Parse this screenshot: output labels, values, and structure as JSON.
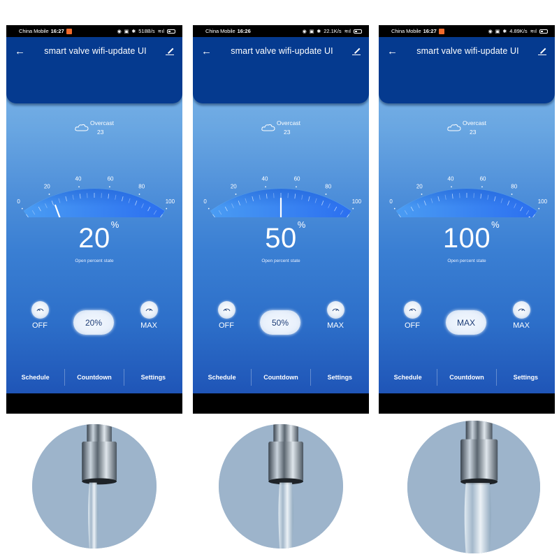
{
  "app": {
    "title": "smart valve wifi-update UI",
    "back_icon": "arrow-left-icon",
    "edit_icon": "pencil-icon"
  },
  "weather": {
    "icon": "cloud-icon",
    "condition": "Overcast",
    "temperature": "23"
  },
  "gauge": {
    "tick_labels": [
      "0",
      "20",
      "40",
      "60",
      "80",
      "100"
    ],
    "min": 0,
    "max": 100
  },
  "value_label": "Open percent state",
  "value_unit": "%",
  "controls": {
    "off_label": "OFF",
    "max_label": "MAX"
  },
  "tabs": [
    "Schedule",
    "Countdown",
    "Settings"
  ],
  "colors": {
    "header": "#053a8f",
    "gauge_accent": "#2f7ff0",
    "pill_text": "#1b3b75"
  },
  "screens": [
    {
      "status": {
        "carrier": "China Mobile",
        "time": "16:27",
        "has_notification": true,
        "net_speed": "518B/s"
      },
      "value": "20",
      "percent": 20,
      "pill_label": "20%",
      "faucet_flow": "low"
    },
    {
      "status": {
        "carrier": "China Mobile",
        "time": "16:26",
        "has_notification": false,
        "net_speed": "22.1K/s"
      },
      "value": "50",
      "percent": 50,
      "pill_label": "50%",
      "faucet_flow": "medium"
    },
    {
      "status": {
        "carrier": "China Mobile",
        "time": "16:27",
        "has_notification": true,
        "net_speed": "4.89K/s"
      },
      "value": "100",
      "percent": 100,
      "pill_label": "MAX",
      "faucet_flow": "high"
    }
  ]
}
